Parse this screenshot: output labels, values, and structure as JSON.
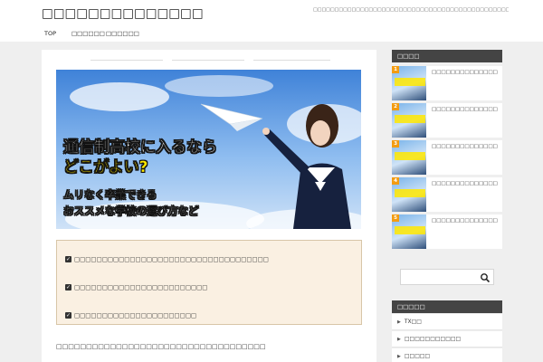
{
  "header": {
    "site_title": "□□□□□□□□□□□□□□",
    "tagline": "□□□□□□□□□□□□□□□□□□□□□□□□□□□□□□□□□□□□□□□□□□□□□□□□□□□□□□□□□□"
  },
  "nav": {
    "items": [
      "TOP",
      "□□□□□□",
      "□□□□□□"
    ]
  },
  "main": {
    "hero": {
      "line1": "通信制高校に入るなら",
      "line2": "どこがよい?",
      "line3": "ムリなく卒業できる",
      "line4": "おススメな学校の選び方など"
    },
    "checklist": [
      "□□□□□□□□□□□□□□□□□□□□□□□□□□□□□□□□□□□",
      "□□□□□□□□□□□□□□□□□□□□□□□□",
      "□□□□□□□□□□□□□□□□□□□□□□"
    ],
    "intro": "□□□□□□□□□□□□□□□□□□□□□□□□□□□□□□□□□□□"
  },
  "sidebar": {
    "ranking_heading": "□□□□",
    "ranking_items": [
      {
        "rank": "1",
        "title": "□□□□□□□□□□□□□□□□□□□□□□□□□□□□□□□□□□□□"
      },
      {
        "rank": "2",
        "title": "□□□□□□□□□□□□□□□□□□□□□□□□□□□□□□□□□□□□"
      },
      {
        "rank": "3",
        "title": "□□□□□□□□□□□□□□□□□□□□□□□□□□□□□"
      },
      {
        "rank": "4",
        "title": "□□□□□□□□□□□□□□□□□□□□□□□□□□□□□□□□□□□"
      },
      {
        "rank": "5",
        "title": "□□□□□□□□□□□□□□□□□□□□□□□□□□□□□□□"
      }
    ],
    "search_placeholder": "",
    "category_heading": "□□□□□",
    "categories": [
      "TX□□",
      "□□□□□□□□□□□",
      "□□□□□"
    ]
  },
  "colors": {
    "accent": "#444444",
    "checklist_bg": "#faf0e2",
    "rank_badge": "#f39c12",
    "hero_yellow": "#ffe800"
  },
  "icons": {
    "check": "check-icon",
    "search": "search-icon",
    "chevron": "chevron-right-icon"
  }
}
